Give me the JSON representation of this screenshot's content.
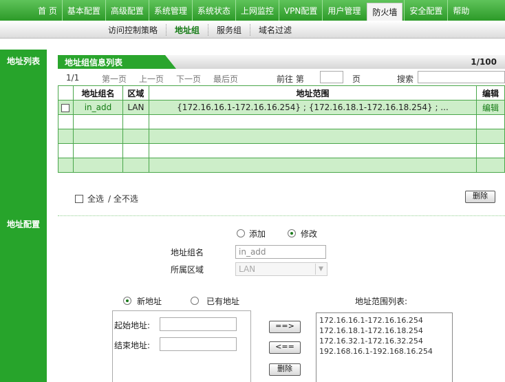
{
  "top_nav": [
    "首 页",
    "基本配置",
    "高级配置",
    "系统管理",
    "系统状态",
    "上网监控",
    "VPN配置",
    "用户管理",
    "防火墙",
    "安全配置",
    "帮助"
  ],
  "sub_nav": [
    "访问控制策略",
    "地址组",
    "服务组",
    "域名过滤"
  ],
  "sidebar": {
    "list_label": "地址列表",
    "config_label": "地址配置"
  },
  "list_panel": {
    "title": "地址组信息列表",
    "page_count": "1/100",
    "pager": {
      "current": "1/1",
      "first": "第一页",
      "prev": "上一页",
      "next": "下一页",
      "last": "最后页",
      "goto_label": "前往 第",
      "page_suffix": "页",
      "search_label": "搜索"
    },
    "columns": {
      "name": "地址组名",
      "zone": "区域",
      "range": "地址范围",
      "edit": "编辑"
    },
    "rows": [
      {
        "name": "in_add",
        "zone": "LAN",
        "range": "{172.16.16.1-172.16.16.254} ; {172.16.18.1-172.16.18.254} ; ...",
        "edit": "编辑"
      }
    ],
    "select_all": "全选",
    "deselect_all": "/ 全不选",
    "delete_label": "删除"
  },
  "config": {
    "mode_add": "添加",
    "mode_modify": "修改",
    "group_name_label": "地址组名",
    "group_name_value": "in_add",
    "zone_label": "所属区域",
    "zone_value": "LAN",
    "new_address": "新地址",
    "existing_address": "已有地址",
    "start_label": "起始地址:",
    "end_label": "结束地址:",
    "add_arrow": "==>",
    "remove_arrow": "<==",
    "delete_label": "删除",
    "range_list_title": "地址范围列表:",
    "range_list": [
      "172.16.16.1-172.16.16.254",
      "172.16.18.1-172.16.18.254",
      "172.16.32.1-172.16.32.254",
      "192.168.16.1-192.168.16.254"
    ]
  },
  "colors": {
    "brand_green": "#27a42b",
    "row_green": "#cdeec9"
  }
}
